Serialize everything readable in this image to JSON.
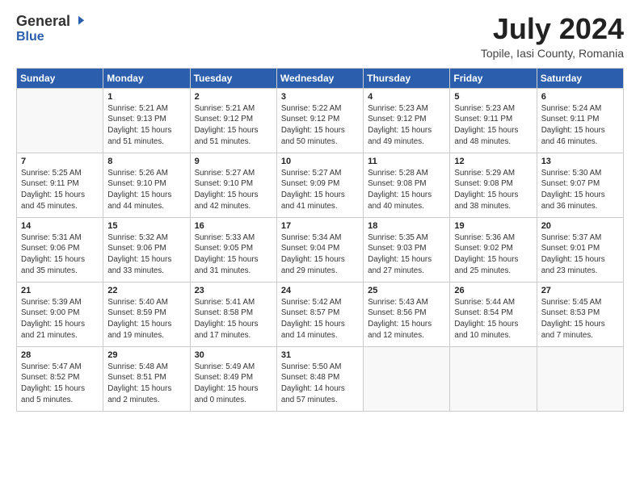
{
  "logo": {
    "general": "General",
    "blue": "Blue"
  },
  "header": {
    "month_year": "July 2024",
    "location": "Topile, Iasi County, Romania"
  },
  "weekdays": [
    "Sunday",
    "Monday",
    "Tuesday",
    "Wednesday",
    "Thursday",
    "Friday",
    "Saturday"
  ],
  "weeks": [
    [
      {
        "day": "",
        "info": ""
      },
      {
        "day": "1",
        "info": "Sunrise: 5:21 AM\nSunset: 9:13 PM\nDaylight: 15 hours\nand 51 minutes."
      },
      {
        "day": "2",
        "info": "Sunrise: 5:21 AM\nSunset: 9:12 PM\nDaylight: 15 hours\nand 51 minutes."
      },
      {
        "day": "3",
        "info": "Sunrise: 5:22 AM\nSunset: 9:12 PM\nDaylight: 15 hours\nand 50 minutes."
      },
      {
        "day": "4",
        "info": "Sunrise: 5:23 AM\nSunset: 9:12 PM\nDaylight: 15 hours\nand 49 minutes."
      },
      {
        "day": "5",
        "info": "Sunrise: 5:23 AM\nSunset: 9:11 PM\nDaylight: 15 hours\nand 48 minutes."
      },
      {
        "day": "6",
        "info": "Sunrise: 5:24 AM\nSunset: 9:11 PM\nDaylight: 15 hours\nand 46 minutes."
      }
    ],
    [
      {
        "day": "7",
        "info": "Sunrise: 5:25 AM\nSunset: 9:11 PM\nDaylight: 15 hours\nand 45 minutes."
      },
      {
        "day": "8",
        "info": "Sunrise: 5:26 AM\nSunset: 9:10 PM\nDaylight: 15 hours\nand 44 minutes."
      },
      {
        "day": "9",
        "info": "Sunrise: 5:27 AM\nSunset: 9:10 PM\nDaylight: 15 hours\nand 42 minutes."
      },
      {
        "day": "10",
        "info": "Sunrise: 5:27 AM\nSunset: 9:09 PM\nDaylight: 15 hours\nand 41 minutes."
      },
      {
        "day": "11",
        "info": "Sunrise: 5:28 AM\nSunset: 9:08 PM\nDaylight: 15 hours\nand 40 minutes."
      },
      {
        "day": "12",
        "info": "Sunrise: 5:29 AM\nSunset: 9:08 PM\nDaylight: 15 hours\nand 38 minutes."
      },
      {
        "day": "13",
        "info": "Sunrise: 5:30 AM\nSunset: 9:07 PM\nDaylight: 15 hours\nand 36 minutes."
      }
    ],
    [
      {
        "day": "14",
        "info": "Sunrise: 5:31 AM\nSunset: 9:06 PM\nDaylight: 15 hours\nand 35 minutes."
      },
      {
        "day": "15",
        "info": "Sunrise: 5:32 AM\nSunset: 9:06 PM\nDaylight: 15 hours\nand 33 minutes."
      },
      {
        "day": "16",
        "info": "Sunrise: 5:33 AM\nSunset: 9:05 PM\nDaylight: 15 hours\nand 31 minutes."
      },
      {
        "day": "17",
        "info": "Sunrise: 5:34 AM\nSunset: 9:04 PM\nDaylight: 15 hours\nand 29 minutes."
      },
      {
        "day": "18",
        "info": "Sunrise: 5:35 AM\nSunset: 9:03 PM\nDaylight: 15 hours\nand 27 minutes."
      },
      {
        "day": "19",
        "info": "Sunrise: 5:36 AM\nSunset: 9:02 PM\nDaylight: 15 hours\nand 25 minutes."
      },
      {
        "day": "20",
        "info": "Sunrise: 5:37 AM\nSunset: 9:01 PM\nDaylight: 15 hours\nand 23 minutes."
      }
    ],
    [
      {
        "day": "21",
        "info": "Sunrise: 5:39 AM\nSunset: 9:00 PM\nDaylight: 15 hours\nand 21 minutes."
      },
      {
        "day": "22",
        "info": "Sunrise: 5:40 AM\nSunset: 8:59 PM\nDaylight: 15 hours\nand 19 minutes."
      },
      {
        "day": "23",
        "info": "Sunrise: 5:41 AM\nSunset: 8:58 PM\nDaylight: 15 hours\nand 17 minutes."
      },
      {
        "day": "24",
        "info": "Sunrise: 5:42 AM\nSunset: 8:57 PM\nDaylight: 15 hours\nand 14 minutes."
      },
      {
        "day": "25",
        "info": "Sunrise: 5:43 AM\nSunset: 8:56 PM\nDaylight: 15 hours\nand 12 minutes."
      },
      {
        "day": "26",
        "info": "Sunrise: 5:44 AM\nSunset: 8:54 PM\nDaylight: 15 hours\nand 10 minutes."
      },
      {
        "day": "27",
        "info": "Sunrise: 5:45 AM\nSunset: 8:53 PM\nDaylight: 15 hours\nand 7 minutes."
      }
    ],
    [
      {
        "day": "28",
        "info": "Sunrise: 5:47 AM\nSunset: 8:52 PM\nDaylight: 15 hours\nand 5 minutes."
      },
      {
        "day": "29",
        "info": "Sunrise: 5:48 AM\nSunset: 8:51 PM\nDaylight: 15 hours\nand 2 minutes."
      },
      {
        "day": "30",
        "info": "Sunrise: 5:49 AM\nSunset: 8:49 PM\nDaylight: 15 hours\nand 0 minutes."
      },
      {
        "day": "31",
        "info": "Sunrise: 5:50 AM\nSunset: 8:48 PM\nDaylight: 14 hours\nand 57 minutes."
      },
      {
        "day": "",
        "info": ""
      },
      {
        "day": "",
        "info": ""
      },
      {
        "day": "",
        "info": ""
      }
    ]
  ]
}
